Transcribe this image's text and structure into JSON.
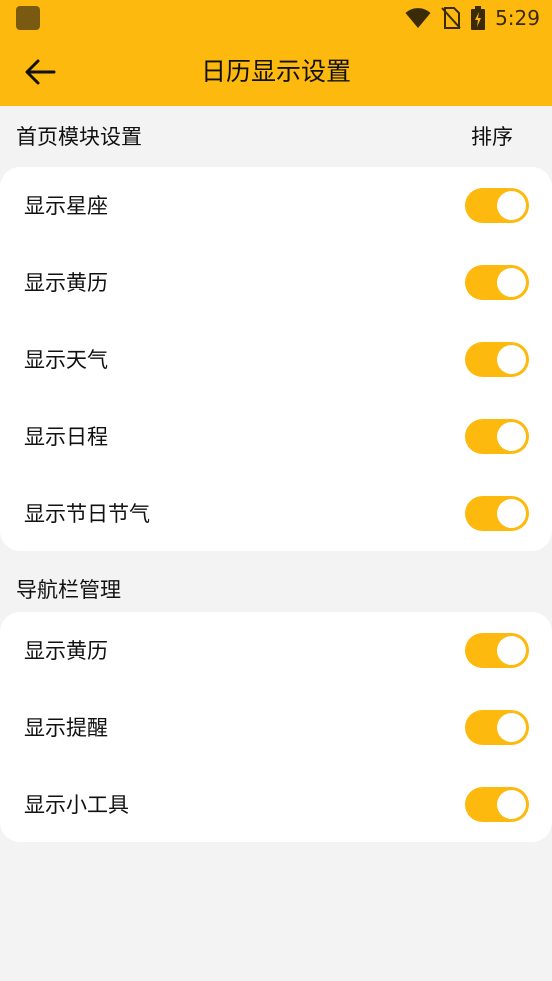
{
  "status_bar": {
    "time": "5:29"
  },
  "header": {
    "title": "日历显示设置"
  },
  "section_home": {
    "title": "首页模块设置",
    "sort_label": "排序",
    "items": [
      {
        "label": "显示星座",
        "on": true
      },
      {
        "label": "显示黄历",
        "on": true
      },
      {
        "label": "显示天气",
        "on": true
      },
      {
        "label": "显示日程",
        "on": true
      },
      {
        "label": "显示节日节气",
        "on": true
      }
    ]
  },
  "section_nav": {
    "title": "导航栏管理",
    "items": [
      {
        "label": "显示黄历",
        "on": true
      },
      {
        "label": "显示提醒",
        "on": true
      },
      {
        "label": "显示小工具",
        "on": true
      }
    ]
  },
  "colors": {
    "accent": "#fdb90d",
    "background": "#f3f3f3",
    "card": "#ffffff"
  },
  "icons": [
    "app-icon",
    "wifi-icon",
    "no-sim-icon",
    "battery-charging-icon",
    "back-arrow-icon"
  ]
}
